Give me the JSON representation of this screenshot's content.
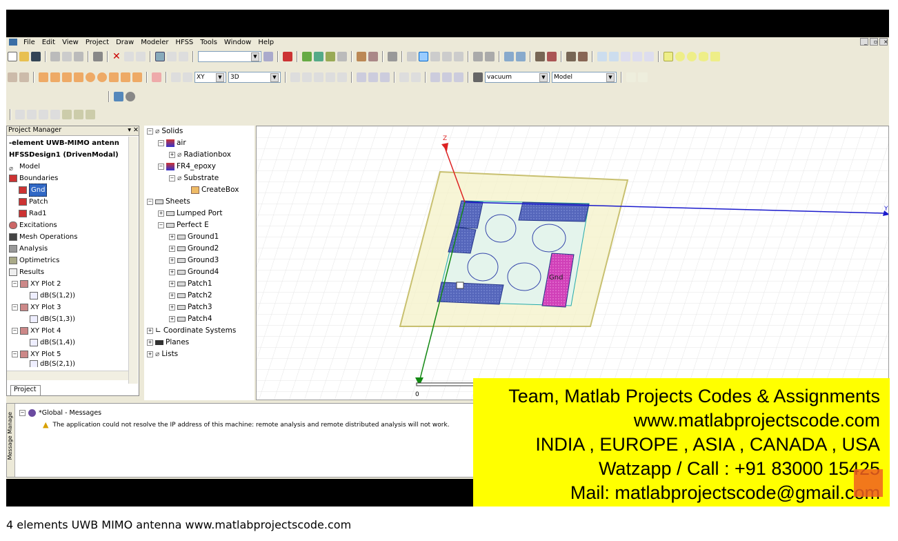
{
  "menu": [
    "File",
    "Edit",
    "View",
    "Project",
    "Draw",
    "Modeler",
    "HFSS",
    "Tools",
    "Window",
    "Help"
  ],
  "toolbar": {
    "plane_combo": "XY",
    "view_combo": "3D",
    "material_combo": "vacuum",
    "model_combo": "Model"
  },
  "project_manager": {
    "title": "Project Manager",
    "project": "-element UWB-MIMO antenn",
    "design": "HFSSDesign1 (DrivenModal)",
    "items": [
      "Model",
      "Boundaries",
      "Gnd",
      "Patch",
      "Rad1",
      "Excitations",
      "Mesh Operations",
      "Analysis",
      "Optimetrics",
      "Results",
      "XY Plot 2",
      "dB(S(1,2))",
      "XY Plot 3",
      "dB(S(1,3))",
      "XY Plot 4",
      "dB(S(1,4))",
      "XY Plot 5",
      "dB(S(2,1))"
    ],
    "tab": "Project"
  },
  "model_tree": {
    "items": [
      "Solids",
      "air",
      "Radiationbox",
      "FR4_epoxy",
      "Substrate",
      "CreateBox",
      "Sheets",
      "Lumped Port",
      "Perfect E",
      "Ground1",
      "Ground2",
      "Ground3",
      "Ground4",
      "Patch1",
      "Patch2",
      "Patch3",
      "Patch4",
      "Coordinate Systems",
      "Planes",
      "Lists"
    ]
  },
  "viewport": {
    "axis_z": "Z",
    "axis_y": "Y",
    "gnd_label": "Gnd",
    "scale_zero": "0"
  },
  "messages": {
    "side_label": "Message Manage",
    "group": "*Global - Messages",
    "text": "The application could not resolve the IP address of this machine: remote analysis and remote distributed analysis will not work."
  },
  "ad": {
    "line1": "Team, Matlab Projects Codes & Assignments",
    "line2": "www.matlabprojectscode.com",
    "line3": "INDIA , EUROPE , ASIA , CANADA , USA",
    "line4": "Watzapp / Call : +91 83000 15425",
    "line5": "Mail: matlabprojectscode@gmail.com"
  },
  "caption": "4 elements UWB MIMO antenna www.matlabprojectscode.com",
  "colors": {
    "window": "#ece9d8",
    "ad_bg": "#ffff00",
    "patch": "#4a5cb0",
    "gnd_highlight": "#e040c0"
  }
}
